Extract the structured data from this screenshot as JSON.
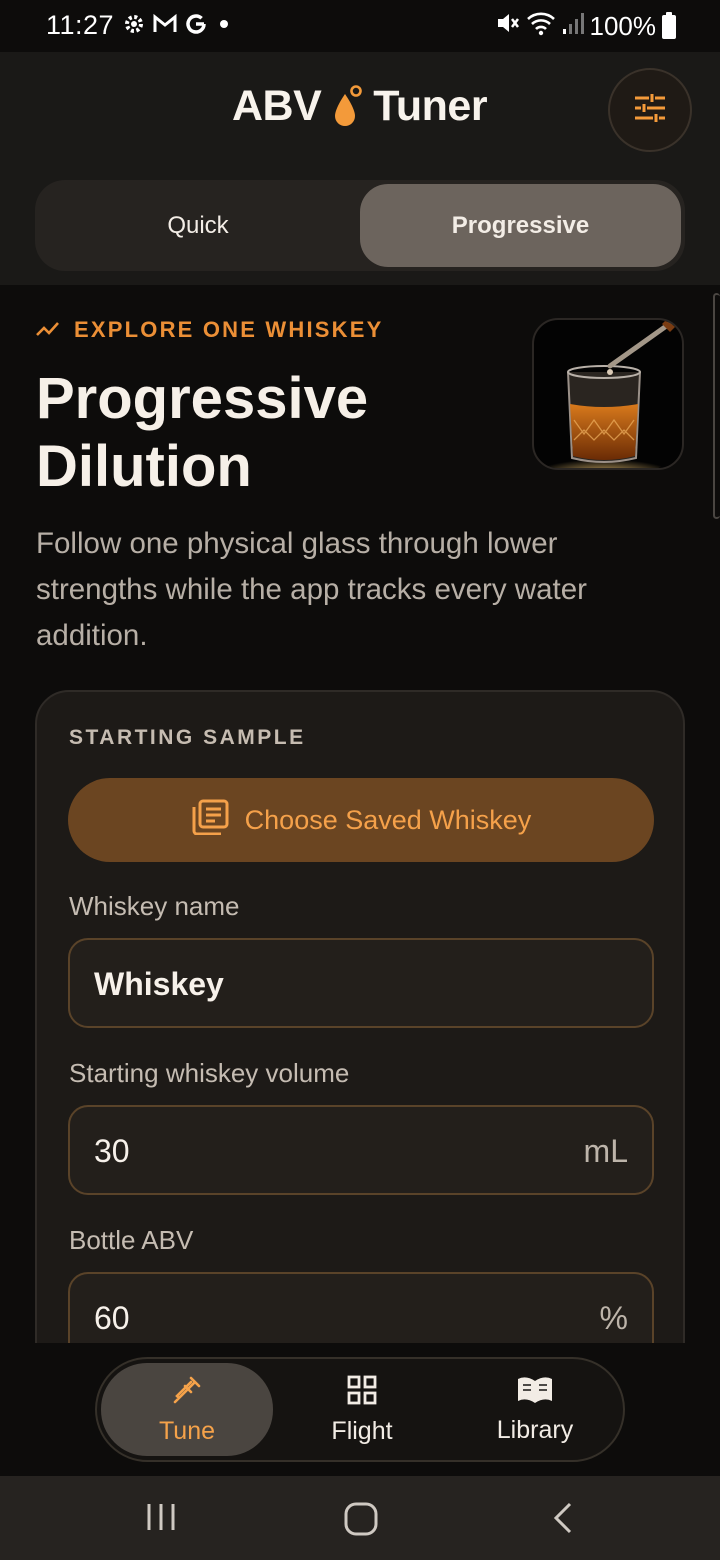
{
  "status_bar": {
    "time": "11:27",
    "battery": "100%",
    "icons": [
      "settings-icon",
      "gmail-icon",
      "google-icon",
      "dot-icon",
      "mute-icon",
      "wifi-icon",
      "signal-icon",
      "battery-icon"
    ]
  },
  "header": {
    "brand_left": "ABV",
    "brand_right": "Tuner",
    "settings_icon": "sliders-icon"
  },
  "mode_toggle": {
    "quick": "Quick",
    "progressive": "Progressive",
    "selected": "Progressive"
  },
  "hero": {
    "eyebrow": "EXPLORE ONE WHISKEY",
    "title": "Progressive Dilution",
    "description": "Follow one physical glass through lower strengths while the app tracks every water addition."
  },
  "starting_sample": {
    "heading": "STARTING SAMPLE",
    "choose_button": "Choose Saved Whiskey",
    "name_label": "Whiskey name",
    "name_value": "Whiskey",
    "volume_label": "Starting whiskey volume",
    "volume_value": "30",
    "volume_unit": "mL",
    "abv_label": "Bottle ABV",
    "abv_value": "60",
    "abv_unit": "%"
  },
  "bottom_nav": {
    "tune": "Tune",
    "flight": "Flight",
    "library": "Library",
    "selected": "Tune"
  },
  "colors": {
    "accent": "#eb8f36",
    "header_bg": "#1a1917",
    "card_bg": "#1d1a17"
  }
}
